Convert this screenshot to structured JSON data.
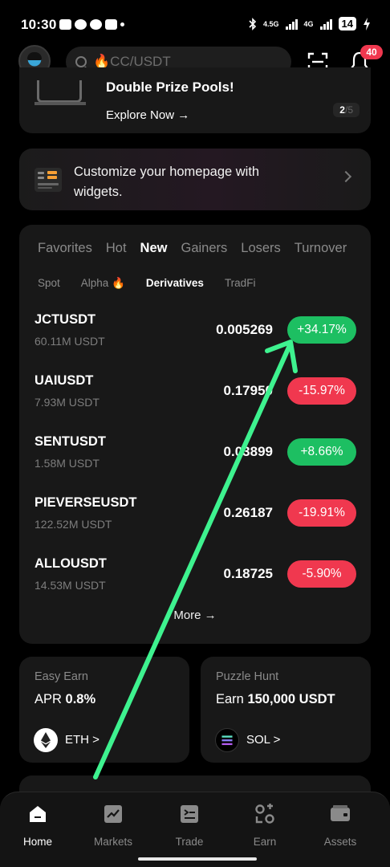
{
  "status_bar": {
    "time": "10:30",
    "signal_1": "4.5G",
    "signal_2": "4G",
    "battery": "14"
  },
  "header": {
    "search_placeholder": "🔥CC/USDT",
    "notification_count": "40"
  },
  "promo": {
    "title": "Double Prize Pools!",
    "link": "Explore Now →",
    "page_current": "2",
    "page_total": "/5"
  },
  "widget": {
    "text": "Customize your homepage with widgets."
  },
  "market": {
    "tabs": [
      "Favorites",
      "Hot",
      "New",
      "Gainers",
      "Losers",
      "Turnover"
    ],
    "active_tab": "New",
    "subtabs": [
      "Spot",
      "Alpha 🔥",
      "Derivatives",
      "TradFi"
    ],
    "active_subtab": "Derivatives",
    "rows": [
      {
        "symbol": "JCTUSDT",
        "volume": "60.11M USDT",
        "price": "0.005269",
        "change": "+34.17%",
        "direction": "up"
      },
      {
        "symbol": "UAIUSDT",
        "volume": "7.93M USDT",
        "price": "0.17950",
        "change": "-15.97%",
        "direction": "down"
      },
      {
        "symbol": "SENTUSDT",
        "volume": "1.58M USDT",
        "price": "0.03899",
        "change": "+8.66%",
        "direction": "up"
      },
      {
        "symbol": "PIEVERSEUSDT",
        "volume": "122.52M USDT",
        "price": "0.26187",
        "change": "-19.91%",
        "direction": "down"
      },
      {
        "symbol": "ALLOUSDT",
        "volume": "14.53M USDT",
        "price": "0.18725",
        "change": "-5.90%",
        "direction": "down"
      }
    ],
    "more_label": "More →"
  },
  "easy_earn": {
    "title": "Easy Earn",
    "apr_label": "APR",
    "apr_value": "0.8%",
    "coin": "ETH >"
  },
  "puzzle_hunt": {
    "title": "Puzzle Hunt",
    "earn_label": "Earn",
    "earn_value": "150,000 USDT",
    "coin": "SOL >"
  },
  "nav": {
    "items": [
      "Home",
      "Markets",
      "Trade",
      "Earn",
      "Assets"
    ],
    "active": "Home"
  },
  "colors": {
    "up": "#1dbf62",
    "down": "#f0384f",
    "annotation_arrow": "#3ef28f",
    "badge": "#f0384f"
  },
  "icons": [
    "search-icon",
    "scan-icon",
    "bell-icon",
    "widget-icon",
    "chevron-right-icon",
    "eth-icon",
    "sol-icon",
    "home-icon",
    "markets-icon",
    "trade-icon",
    "earn-icon",
    "assets-icon"
  ]
}
